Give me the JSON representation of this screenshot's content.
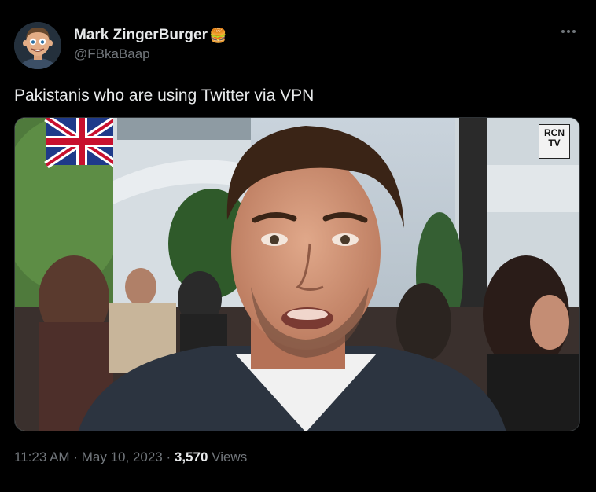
{
  "tweet": {
    "author": {
      "display_name": "Mark ZingerBurger",
      "emoji": "🍔",
      "handle": "@FBkaBaap",
      "avatar_icon": "cartoon-avatar"
    },
    "more_icon": "more-dots-icon",
    "text": "Pakistanis who are using Twitter via VPN",
    "media": {
      "watermark_line1": "RCN",
      "watermark_line2": "TV"
    },
    "time": "11:23 AM",
    "sep1": "·",
    "date": "May 10, 2023",
    "sep2": "·",
    "views_count": "3,570",
    "views_label": "Views"
  },
  "colors": {
    "background": "#000000",
    "text_primary": "#e7e9ea",
    "text_secondary": "#71767b",
    "border": "#2f3336"
  }
}
